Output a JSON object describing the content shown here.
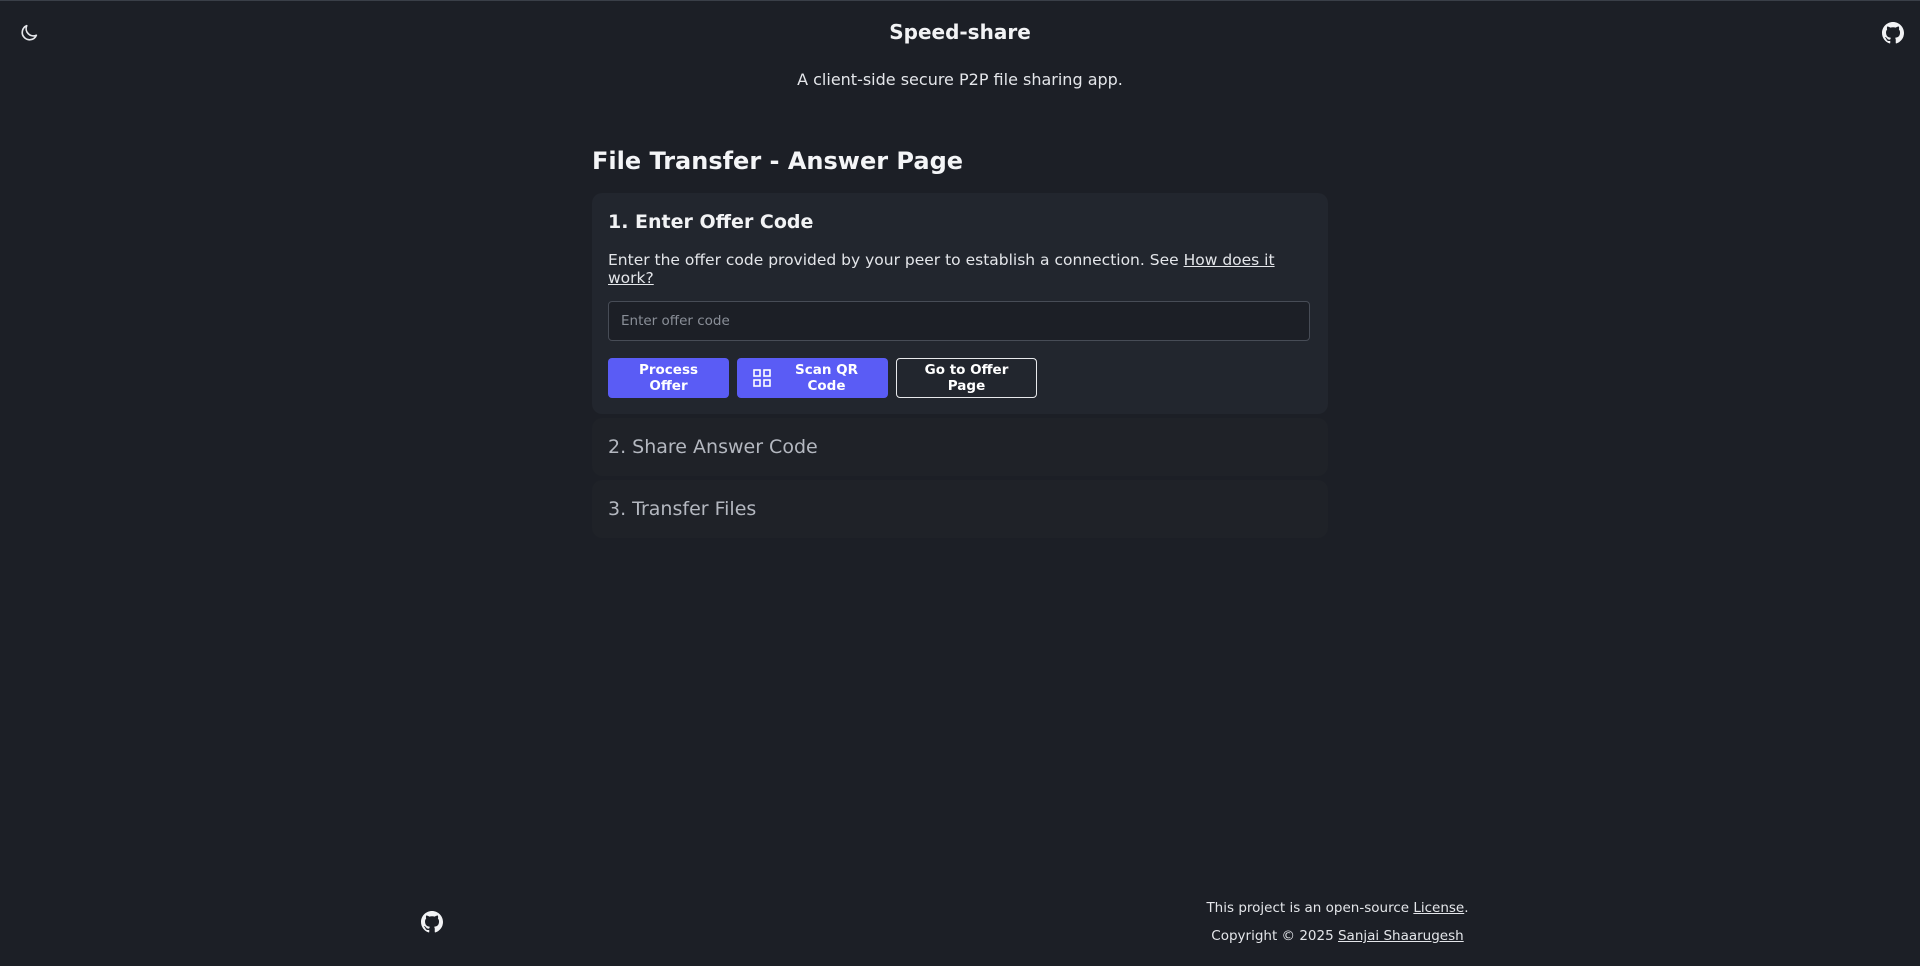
{
  "header": {
    "title": "Speed-share",
    "subtitle": "A client-side secure P2P file sharing app.",
    "theme_icon": "moon-icon",
    "github_icon": "github-icon"
  },
  "page": {
    "title": "File Transfer - Answer Page"
  },
  "step1": {
    "title": "1. Enter Offer Code",
    "description": "Enter the offer code provided by your peer to establish a connection. See ",
    "help_link": "How does it work?",
    "input_value": "",
    "input_placeholder": "Enter offer code",
    "buttons": {
      "process": "Process Offer",
      "scan": "Scan QR Code",
      "scan_icon": "qr-code-icon",
      "goto_offer": "Go to Offer Page"
    }
  },
  "step2": {
    "title": "2. Share Answer Code"
  },
  "step3": {
    "title": "3. Transfer Files"
  },
  "footer": {
    "license_prefix": "This project is an open-source ",
    "license_link": "License",
    "license_suffix": ".",
    "copyright_prefix": "Copyright © 2025 ",
    "author_link": "Sanjai Shaarugesh",
    "github_icon": "github-icon"
  },
  "colors": {
    "background": "#1c1f26",
    "card": "#22262e",
    "accent": "#5a5cf5"
  }
}
